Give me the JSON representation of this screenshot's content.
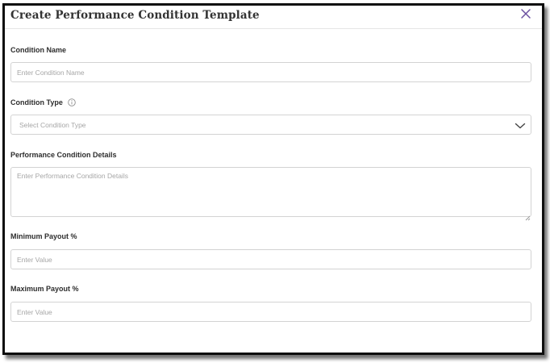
{
  "dialog": {
    "title": "Create Performance Condition Template",
    "close_icon": "close-icon"
  },
  "form": {
    "condition_name": {
      "label": "Condition Name",
      "placeholder": "Enter Condition Name",
      "value": ""
    },
    "condition_type": {
      "label": "Condition Type",
      "info_icon": "info-icon",
      "placeholder": "Select Condition Type",
      "chevron_icon": "chevron-down-icon"
    },
    "details": {
      "label": "Performance Condition Details",
      "placeholder": "Enter Performance Condition Details",
      "value": ""
    },
    "minimum_payout": {
      "label": "Minimum Payout %",
      "placeholder": "Enter Value",
      "value": ""
    },
    "maximum_payout": {
      "label": "Maximum Payout %",
      "placeholder": "Enter Value",
      "value": ""
    }
  },
  "colors": {
    "accent_close": "#6a4fa0",
    "border": "#d3d3d3",
    "placeholder": "#a6a6a6"
  }
}
